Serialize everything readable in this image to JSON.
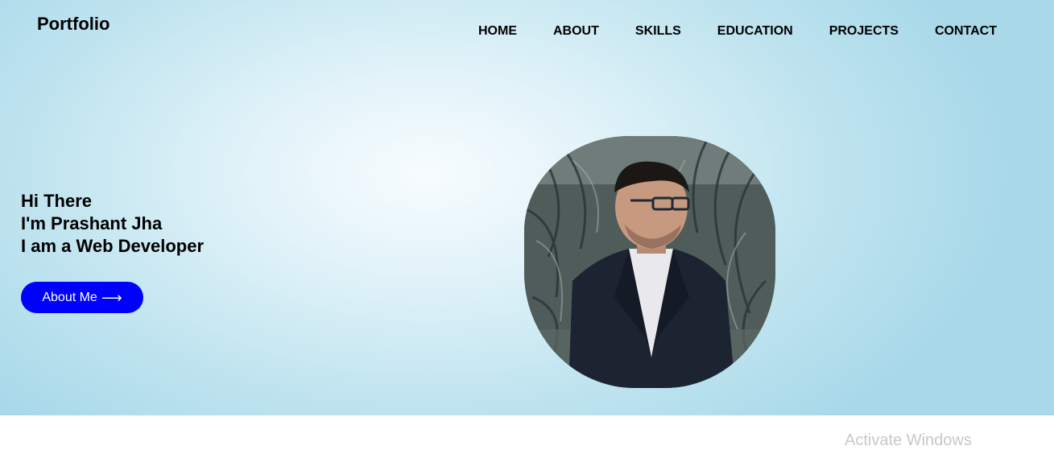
{
  "header": {
    "logo": "Portfolio",
    "nav": [
      "HOME",
      "ABOUT",
      "SKILLS",
      "EDUCATION",
      "PROJECTS",
      "CONTACT"
    ]
  },
  "hero": {
    "greeting": "Hi There",
    "name_line": "I'm Prashant Jha",
    "role_line": "I am a Web Developer",
    "button_label": "About Me",
    "button_arrow": "⟶"
  },
  "colors": {
    "button_bg": "#0000ff",
    "hero_bg_edge": "#a9d9e9",
    "hero_bg_center": "#f7fcfe"
  },
  "system": {
    "watermark": "Activate Windows"
  }
}
